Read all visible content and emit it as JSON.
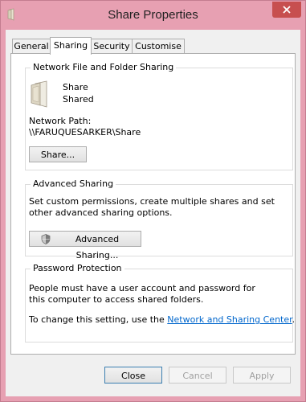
{
  "window": {
    "title": "Share Properties"
  },
  "tabs": [
    {
      "label": "General"
    },
    {
      "label": "Sharing"
    },
    {
      "label": "Security"
    },
    {
      "label": "Customise"
    }
  ],
  "network_sharing": {
    "title": "Network File and Folder Sharing",
    "folder_name": "Share",
    "folder_status": "Shared",
    "path_label": "Network Path:",
    "path_value": "\\\\FARUQUESARKER\\Share",
    "share_button": "Share..."
  },
  "advanced_sharing": {
    "title": "Advanced Sharing",
    "description": "Set custom permissions, create multiple shares and set other advanced sharing options.",
    "button": "Advanced Sharing..."
  },
  "password_protection": {
    "title": "Password Protection",
    "description": "People must have a user account and password for this computer to access shared folders.",
    "change_text": "To change this setting, use the ",
    "link": "Network and Sharing Center",
    "suffix": "."
  },
  "footer": {
    "close": "Close",
    "cancel": "Cancel",
    "apply": "Apply"
  }
}
